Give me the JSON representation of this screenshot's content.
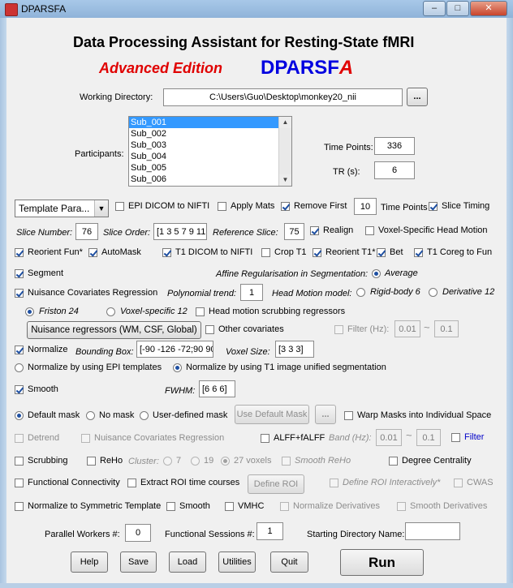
{
  "window": {
    "title": "DPARSFA",
    "minimize": "–",
    "maximize": "□",
    "close": "✕"
  },
  "header": {
    "title": "Data Processing Assistant for Resting-State fMRI",
    "edition": "Advanced Edition",
    "brand_main": "DPARSF",
    "brand_suffix": "A"
  },
  "working_directory": {
    "label": "Working Directory:",
    "value": "C:\\Users\\Guo\\Desktop\\monkey20_nii",
    "browse": "..."
  },
  "participants": {
    "label": "Participants:",
    "items": [
      "Sub_001",
      "Sub_002",
      "Sub_003",
      "Sub_004",
      "Sub_005",
      "Sub_006"
    ],
    "selected_index": 0
  },
  "time_points": {
    "label": "Time Points:",
    "value": "336"
  },
  "tr": {
    "label": "TR (s):",
    "value": "6"
  },
  "template": {
    "value": "Template Para..."
  },
  "row_epi": {
    "epi_dicom": "EPI DICOM to NIFTI",
    "apply_mats": "Apply Mats",
    "remove_first": "Remove First",
    "remove_first_value": "10",
    "time_points": "Time Points",
    "slice_timing": "Slice Timing"
  },
  "row_slice": {
    "slice_number": "Slice Number:",
    "slice_number_value": "76",
    "slice_order": "Slice Order:",
    "slice_order_value": "[1 3 5 7 9 11",
    "reference_slice": "Reference Slice:",
    "reference_slice_value": "75",
    "realign": "Realign",
    "voxel_head_motion": "Voxel-Specific Head Motion"
  },
  "row_reorient": {
    "reorient_fun": "Reorient Fun*",
    "automask": "AutoMask",
    "t1_dicom": "T1 DICOM to NIFTI",
    "crop_t1": "Crop T1",
    "reorient_t1": "Reorient T1*",
    "bet": "Bet",
    "t1_coreg": "T1 Coreg to Fun"
  },
  "segment": {
    "label": "Segment",
    "affine": "Affine Regularisation in Segmentation:",
    "average": "Average"
  },
  "nuisance": {
    "label": "Nuisance Covariates Regression",
    "poly_label": "Polynomial trend:",
    "poly_value": "1",
    "hm_model": "Head Motion model:",
    "rigid": "Rigid-body 6",
    "derivative": "Derivative 12",
    "friston": "Friston 24",
    "voxel_specific": "Voxel-specific 12",
    "scrubbing_regressors": "Head motion scrubbing regressors",
    "regressors_button": "Nuisance regressors (WM, CSF, Global)",
    "other_cov": "Other covariates",
    "filter": "Filter (Hz):",
    "filter_low": "0.01",
    "tilde": "~",
    "filter_high": "0.1"
  },
  "normalize": {
    "label": "Normalize",
    "bbox_label": "Bounding Box:",
    "bbox_value": "[-90 -126 -72;90 90",
    "voxel_label": "Voxel Size:",
    "voxel_value": "[3 3 3]",
    "by_epi": "Normalize by using EPI templates",
    "by_t1": "Normalize by using T1 image unified segmentation"
  },
  "smooth": {
    "label": "Smooth",
    "fwhm_label": "FWHM:",
    "fwhm_value": "[6 6 6]"
  },
  "mask": {
    "default": "Default mask",
    "none": "No mask",
    "user": "User-defined mask",
    "use_default_button": "Use Default Mask",
    "browse": "...",
    "warp": "Warp Masks into Individual Space"
  },
  "row_detrend": {
    "detrend": "Detrend",
    "nuisance": "Nuisance Covariates Regression",
    "alff": "ALFF+fALFF",
    "band": "Band (Hz):",
    "band_low": "0.01",
    "tilde": "~",
    "band_high": "0.1",
    "filter": "Filter"
  },
  "row_scrub": {
    "scrubbing": "Scrubbing",
    "reho": "ReHo",
    "cluster": "Cluster:",
    "c7": "7",
    "c19": "19",
    "c27": "27 voxels",
    "smooth_reho": "Smooth ReHo",
    "degree": "Degree Centrality"
  },
  "row_fc": {
    "fc": "Functional Connectivity",
    "extract_roi": "Extract ROI time courses",
    "define_roi": "Define ROI",
    "define_interactive": "Define ROI Interactively*",
    "cwas": "CWAS"
  },
  "row_sym": {
    "normalize_sym": "Normalize to Symmetric Template",
    "smooth": "Smooth",
    "vmhc": "VMHC",
    "norm_deriv": "Normalize Derivatives",
    "smooth_deriv": "Smooth Derivatives"
  },
  "bottom": {
    "workers_label": "Parallel Workers #:",
    "workers_value": "0",
    "sessions_label": "Functional Sessions #:",
    "sessions_value": "1",
    "start_dir_label": "Starting Directory Name:",
    "start_dir_value": ""
  },
  "buttons": {
    "help": "Help",
    "save": "Save",
    "load": "Load",
    "utilities": "Utilities",
    "quit": "Quit",
    "run": "Run"
  },
  "colors": {
    "edition_red": "#e00000",
    "brand_blue": "#0000e0",
    "selection": "#3399ff",
    "filter_link": "#0000c8"
  }
}
